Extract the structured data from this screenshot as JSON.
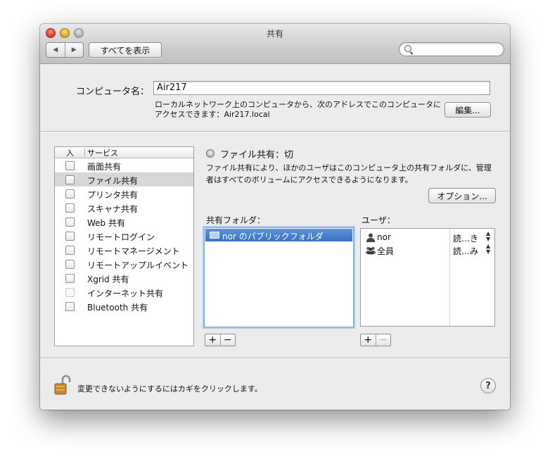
{
  "window": {
    "title": "共有"
  },
  "toolbar": {
    "back_glyph": "◀",
    "forward_glyph": "▶",
    "show_all_label": "すべてを表示",
    "search_placeholder": ""
  },
  "computer": {
    "name_label": "コンピュータ名：",
    "name_value": "Air217",
    "address_line1": "ローカルネットワーク上のコンピュータから、次のアドレスでこのコンピュータに",
    "address_line2": "アクセスできます：Air217.local",
    "edit_label": "編集..."
  },
  "services": {
    "header_on": "入",
    "header_service": "サービス",
    "items": [
      {
        "label": "画面共有",
        "checked": false,
        "selected": false,
        "disabled": false
      },
      {
        "label": "ファイル共有",
        "checked": false,
        "selected": true,
        "disabled": false
      },
      {
        "label": "プリンタ共有",
        "checked": false,
        "selected": false,
        "disabled": false
      },
      {
        "label": "スキャナ共有",
        "checked": false,
        "selected": false,
        "disabled": false
      },
      {
        "label": "Web 共有",
        "checked": false,
        "selected": false,
        "disabled": false
      },
      {
        "label": "リモートログイン",
        "checked": false,
        "selected": false,
        "disabled": false
      },
      {
        "label": "リモートマネージメント",
        "checked": false,
        "selected": false,
        "disabled": false
      },
      {
        "label": "リモートアップルイベント",
        "checked": false,
        "selected": false,
        "disabled": false
      },
      {
        "label": "Xgrid 共有",
        "checked": false,
        "selected": false,
        "disabled": false
      },
      {
        "label": "インターネット共有",
        "checked": false,
        "selected": false,
        "disabled": true
      },
      {
        "label": "Bluetooth 共有",
        "checked": false,
        "selected": false,
        "disabled": false
      }
    ]
  },
  "detail": {
    "status": "ファイル共有：切",
    "description_line1": "ファイル共有により、ほかのユーザはこのコンピュータ上の共有フォルダに、管理",
    "description_line2": "者はすべてのボリュームにアクセスできるようになります。",
    "options_label": "オプション..."
  },
  "shared_folders": {
    "label": "共有フォルダ：",
    "items": [
      "nor のパブリックフォルダ"
    ],
    "add_label": "+",
    "remove_label": "−"
  },
  "users": {
    "label": "ユーザ：",
    "items": [
      {
        "name": "nor",
        "permission": "読…き",
        "icon": "person-icon"
      },
      {
        "name": "全員",
        "permission": "読…み",
        "icon": "group-icon"
      }
    ],
    "add_label": "+",
    "remove_label": "−"
  },
  "footer": {
    "lock_text": "変更できないようにするにはカギをクリックします。",
    "help_label": "?"
  },
  "colors": {
    "window_bg": "#ececec",
    "selection_blue": "#3a72c5",
    "selected_row_gray": "#d7d7d7"
  }
}
